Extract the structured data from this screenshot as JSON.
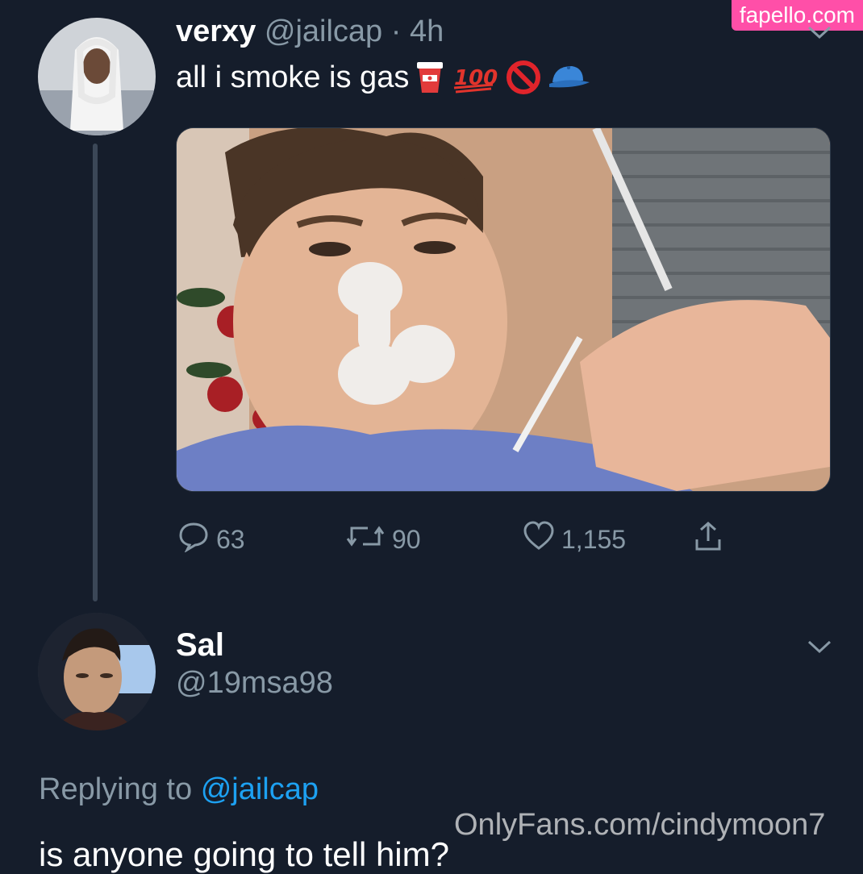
{
  "watermarks": {
    "top": "fapello.com",
    "bottom": "OnlyFans.com/cindymoon7"
  },
  "tweet": {
    "author_name": "verxy",
    "author_handle": "@jailcap",
    "separator": "·",
    "time": "4h",
    "text": "all i smoke is gas",
    "emojis": [
      "cup-icon",
      "hundred-points-icon",
      "no-entry-icon",
      "blue-cap-icon"
    ],
    "actions": {
      "replies": "63",
      "retweets": "90",
      "likes": "1,155"
    }
  },
  "reply": {
    "author_name": "Sal",
    "author_handle": "@19msa98",
    "replying_label": "Replying to",
    "replying_handle": "@jailcap",
    "text": "is anyone going to tell him?"
  },
  "colors": {
    "background": "#151d2b",
    "muted": "#8899a6",
    "link": "#1da1f2",
    "watermark": "#ff4fa8"
  }
}
